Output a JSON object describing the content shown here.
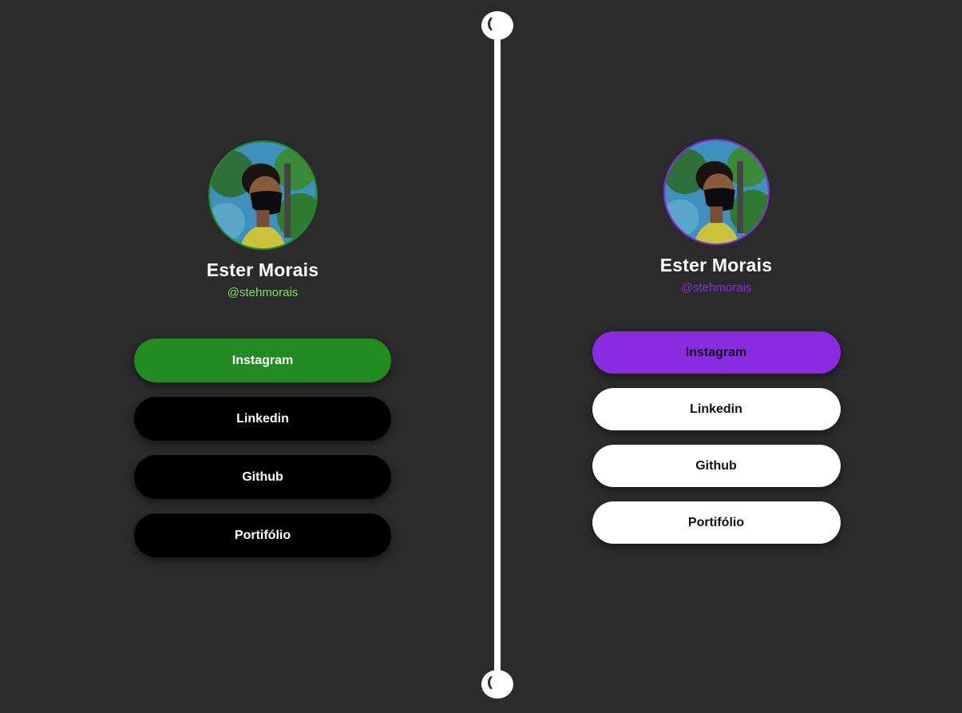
{
  "colors": {
    "background": "#2b2b2b",
    "left_accent": "#218a21",
    "left_handle": "#7be35a",
    "right_accent": "#8a2be2",
    "divider": "#ffffff"
  },
  "left_panel": {
    "name": "Ester Morais",
    "handle": "@stehmorais",
    "links": [
      {
        "label": "Instagram"
      },
      {
        "label": "Linkedin"
      },
      {
        "label": "Github"
      },
      {
        "label": "Portifólio"
      }
    ]
  },
  "right_panel": {
    "name": "Ester Morais",
    "handle": "@stehmorais",
    "links": [
      {
        "label": "Instagram"
      },
      {
        "label": "Linkedin"
      },
      {
        "label": "Github"
      },
      {
        "label": "Portifólio"
      }
    ]
  },
  "icons": {
    "divider_handle": "slider-knob-icon",
    "avatar": "profile-photo"
  }
}
